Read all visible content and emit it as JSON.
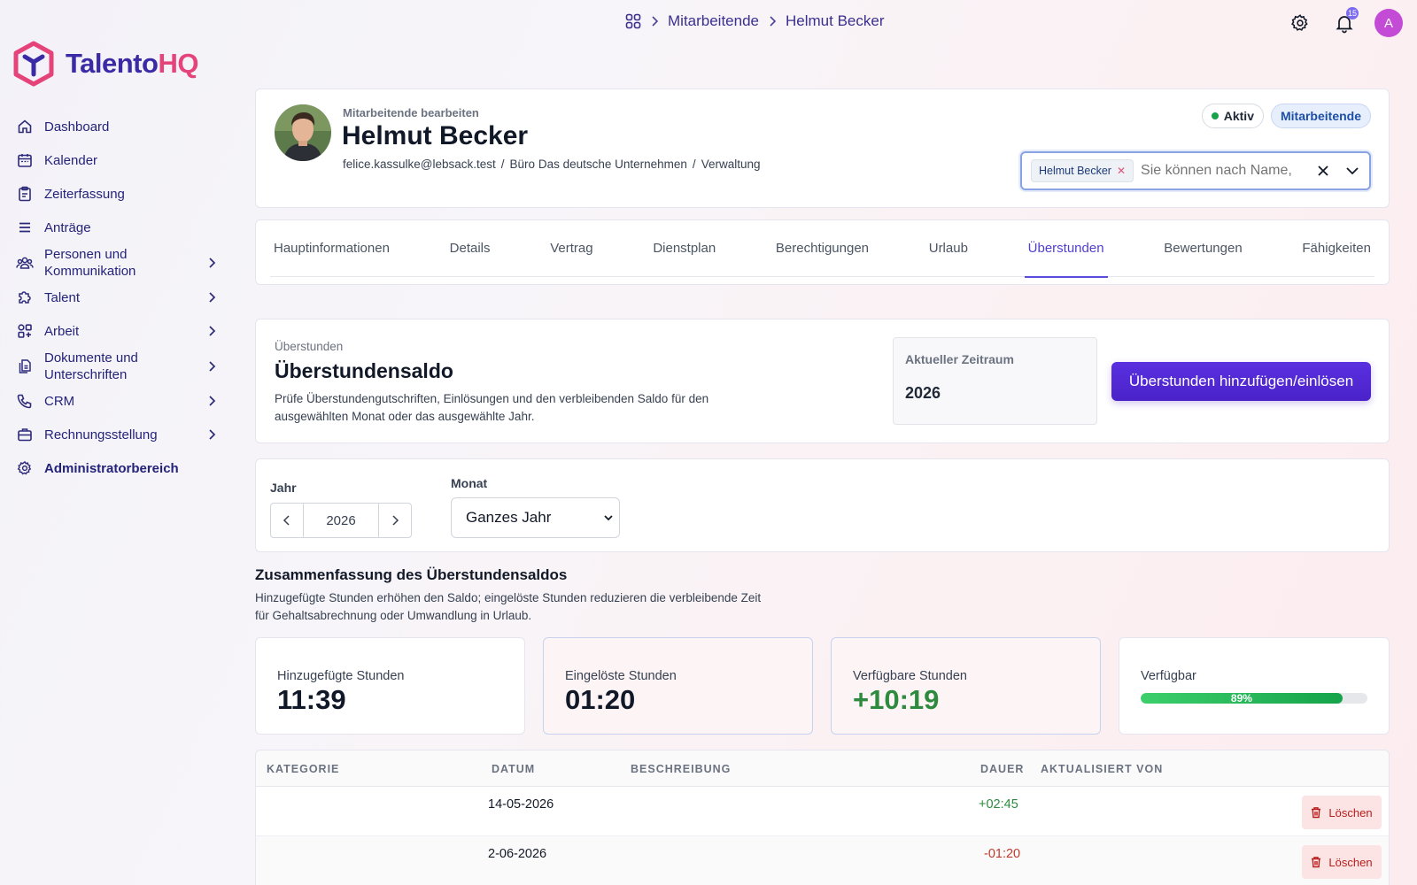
{
  "breadcrumb": {
    "home_icon": "apps-grid-icon",
    "items": [
      "Mitarbeitende",
      "Helmut Becker"
    ]
  },
  "topbar": {
    "settings_icon": "gear-icon",
    "notifications_icon": "bell-icon",
    "notifications_count": "15",
    "avatar_initial": "A"
  },
  "brand": {
    "name_part1": "Talento",
    "name_part2": "HQ",
    "color_primary": "#3a2aa6",
    "color_accent": "#e5447b"
  },
  "sidebar": {
    "items": [
      {
        "label": "Dashboard",
        "icon": "home-icon",
        "expandable": false
      },
      {
        "label": "Kalender",
        "icon": "calendar-icon",
        "expandable": false
      },
      {
        "label": "Zeiterfassung",
        "icon": "clipboard-icon",
        "expandable": false
      },
      {
        "label": "Anträge",
        "icon": "list-icon",
        "expandable": false
      },
      {
        "label": "Personen und Kommunikation",
        "icon": "users-icon",
        "expandable": true
      },
      {
        "label": "Talent",
        "icon": "puzzle-icon",
        "expandable": true
      },
      {
        "label": "Arbeit",
        "icon": "shapes-icon",
        "expandable": true
      },
      {
        "label": "Dokumente und Unterschriften",
        "icon": "documents-icon",
        "expandable": true
      },
      {
        "label": "CRM",
        "icon": "phone-icon",
        "expandable": true
      },
      {
        "label": "Rechnungsstellung",
        "icon": "briefcase-icon",
        "expandable": true
      },
      {
        "label": "Administratorbereich",
        "icon": "gear-icon",
        "expandable": false
      }
    ]
  },
  "profile": {
    "subtitle": "Mitarbeitende bearbeiten",
    "name": "Helmut Becker",
    "email": "felice.kassulke@lebsack.test",
    "sep": "/",
    "office": "Büro Das deutsche Unternehmen",
    "department": "Verwaltung",
    "status_badge": "Aktiv",
    "status_color": "#16a34a",
    "role_badge": "Mitarbeitende",
    "employee_select": {
      "selected_chip": "Helmut Becker",
      "placeholder": "Sie können nach Name,"
    }
  },
  "tabs": [
    {
      "label": "Hauptinformationen",
      "active": false
    },
    {
      "label": "Details",
      "active": false
    },
    {
      "label": "Vertrag",
      "active": false
    },
    {
      "label": "Dienstplan",
      "active": false
    },
    {
      "label": "Berechtigungen",
      "active": false
    },
    {
      "label": "Urlaub",
      "active": false
    },
    {
      "label": "Überstunden",
      "active": true
    },
    {
      "label": "Bewertungen",
      "active": false
    },
    {
      "label": "Fähigkeiten",
      "active": false
    }
  ],
  "saldo": {
    "eyebrow": "Überstunden",
    "title": "Überstundensaldo",
    "description": "Prüfe Überstundengutschriften, Einlösungen und den verbleibenden Saldo für den ausgewählten Monat oder das ausgewählte Jahr.",
    "period_label": "Aktueller Zeitraum",
    "period_value": "2026",
    "primary_button": "Überstunden hinzufügen/einlösen"
  },
  "filters": {
    "year_label": "Jahr",
    "year_value": "2026",
    "month_label": "Monat",
    "month_value": "Ganzes Jahr"
  },
  "summary": {
    "title": "Zusammenfassung des Überstundensaldos",
    "description": "Hinzugefügte Stunden erhöhen den Saldo; eingelöste Stunden reduzieren die verbleibende Zeit für Gehaltsabrechnung oder Umwandlung in Urlaub.",
    "added_label": "Hinzugefügte Stunden",
    "added_value": "11:39",
    "redeemed_label": "Eingelöste Stunden",
    "redeemed_value": "01:20",
    "available_label": "Verfügbare Stunden",
    "available_value": "+10:19",
    "percent_label": "Verfügbar",
    "percent_value": 89,
    "percent_text": "89%"
  },
  "table": {
    "columns": [
      "KATEGORIE",
      "DATUM",
      "BESCHREIBUNG",
      "DAUER",
      "AKTUALISIERT VON"
    ],
    "delete_label": "Löschen",
    "rows": [
      {
        "category": "",
        "date": "14-05-2026",
        "description": "",
        "duration": "+02:45",
        "updated_by": ""
      },
      {
        "category": "",
        "date": "2-06-2026",
        "description": "",
        "duration": "-01:20",
        "updated_by": ""
      }
    ]
  }
}
